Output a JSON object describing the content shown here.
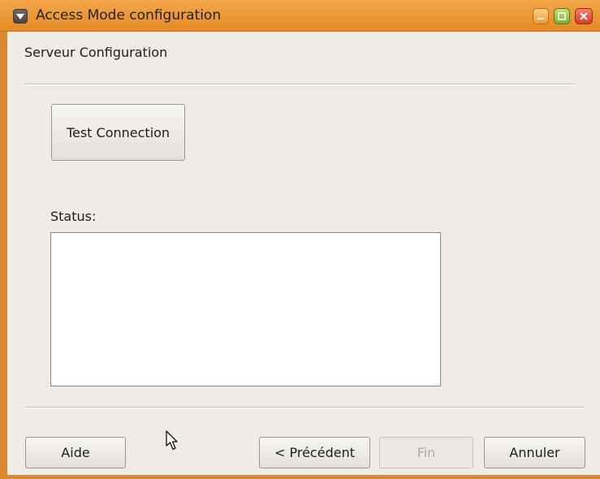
{
  "window": {
    "title": "Access Mode configuration"
  },
  "header": {
    "section_title": "Serveur Configuration"
  },
  "main": {
    "test_button_label": "Test Connection",
    "status_label": "Status:",
    "status_text": ""
  },
  "footer": {
    "help_label": "Aide",
    "previous_label": "< Précédent",
    "finish_label": "Fin",
    "cancel_label": "Annuler"
  },
  "icons": {
    "window_menu": "chevron-down-icon",
    "minimize": "minimize-icon",
    "maximize": "maximize-icon",
    "close": "close-icon",
    "cursor": "mouse-pointer-icon"
  },
  "colors": {
    "titlebar": "#e48a24",
    "window_border": "#d98a2e",
    "background": "#efebe7"
  }
}
